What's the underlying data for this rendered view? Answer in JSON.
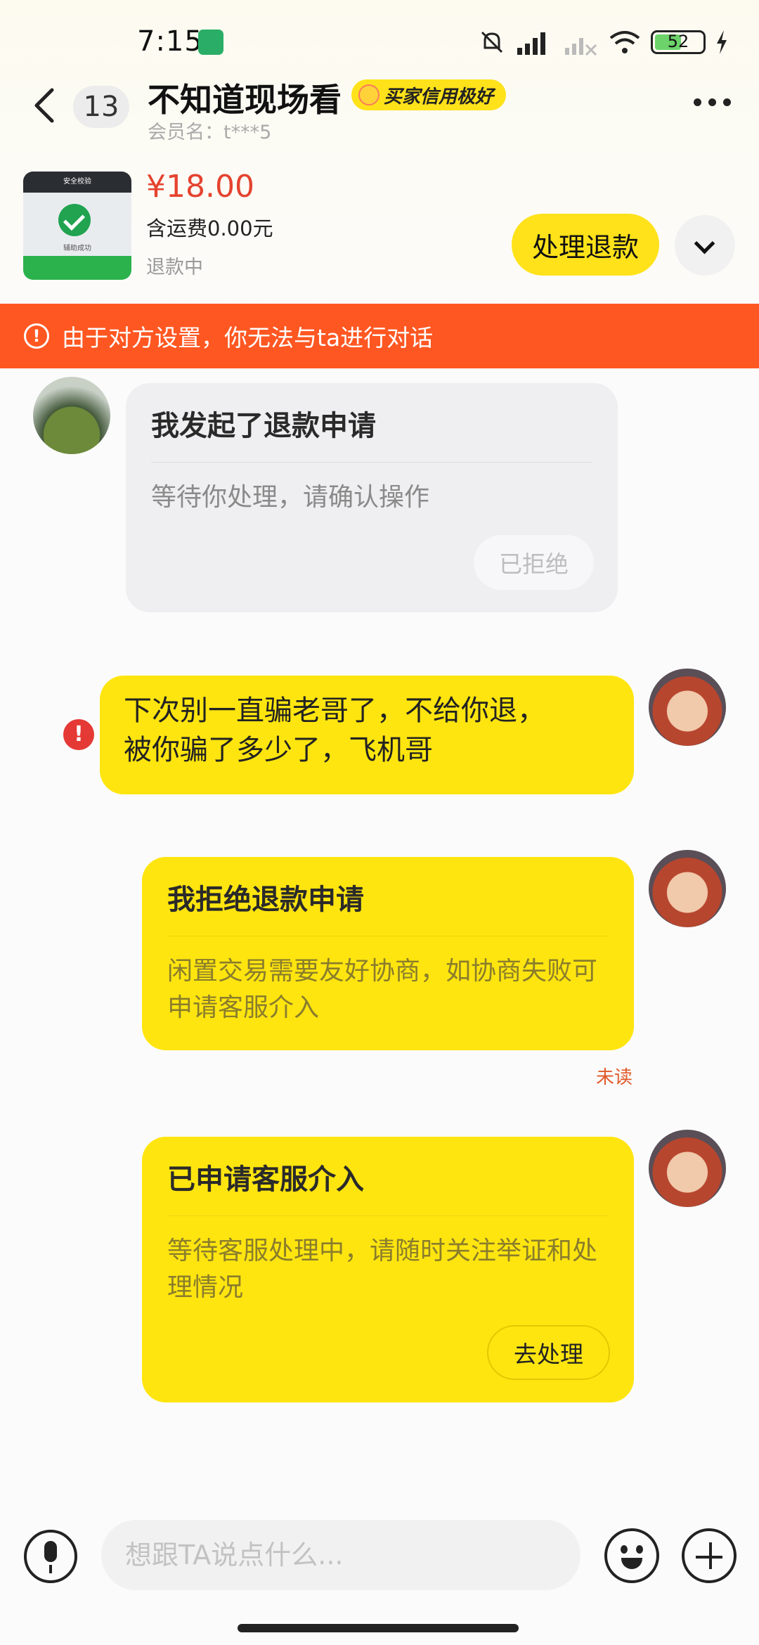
{
  "status_bar": {
    "time": "7:15",
    "battery": "52"
  },
  "header": {
    "back_count": "13",
    "title": "不知道现场看",
    "badge": "买家信用极好",
    "member": "会员名：t***5"
  },
  "product": {
    "thumb_caption": "安全校验",
    "thumb_text": "辅助成功",
    "price": "¥18.00",
    "shipping": "含运费0.00元",
    "status": "退款中",
    "refund_button": "处理退款"
  },
  "banner": "由于对方设置，你无法与ta进行对话",
  "messages": {
    "refund_request": {
      "title": "我发起了退款申请",
      "desc": "等待你处理，请确认操作",
      "action": "已拒绝"
    },
    "text_line1": "下次别一直骗老哥了，不给你退，",
    "text_line2": "被你骗了多少了，飞机哥",
    "reject_card": {
      "title": "我拒绝退款申请",
      "desc": "闲置交易需要友好协商，如协商失败可申请客服介入",
      "status": "未读"
    },
    "service_card": {
      "title": "已申请客服介入",
      "desc": "等待客服处理中，请随时关注举证和处理情况",
      "action": "去处理"
    }
  },
  "input": {
    "placeholder": "想跟TA说点什么..."
  },
  "colors": {
    "accent_yellow": "#ffe50f",
    "banner_orange": "#ff5722",
    "price_red": "#e5432f"
  }
}
